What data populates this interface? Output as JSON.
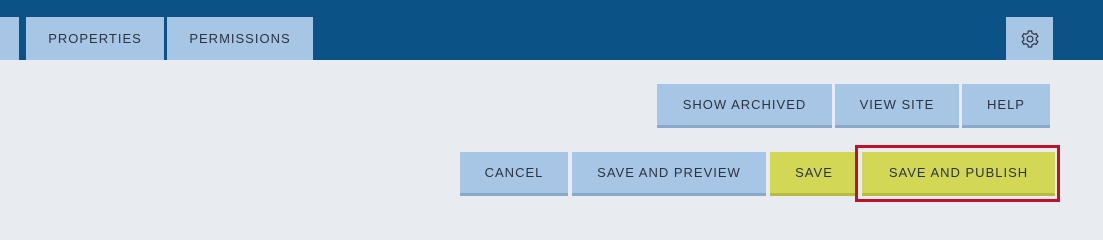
{
  "header": {
    "tabs": [
      {
        "label": ""
      },
      {
        "label": "PROPERTIES"
      },
      {
        "label": "PERMISSIONS"
      }
    ],
    "settings_icon": "gear-icon"
  },
  "actions": {
    "top_row": {
      "show_archived": "SHOW ARCHIVED",
      "view_site": "VIEW SITE",
      "help": "HELP"
    },
    "bottom_row": {
      "cancel": "CANCEL",
      "save_and_preview": "SAVE AND PREVIEW",
      "save": "SAVE",
      "save_and_publish": "SAVE AND PUBLISH"
    }
  },
  "colors": {
    "header_bg": "#0b5286",
    "tab_bg": "#a7c5e4",
    "page_bg": "#e8ecf1",
    "primary_button_bg": "#d3d756",
    "highlight_border": "#c2102b"
  }
}
